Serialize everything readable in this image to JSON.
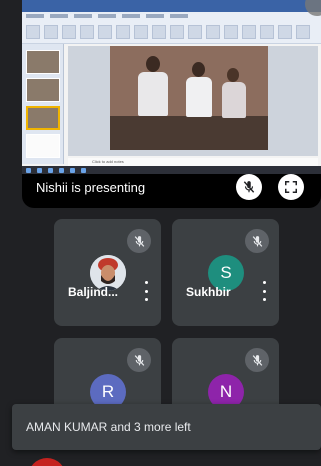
{
  "presentation": {
    "presenter_label": "Nishii is presenting",
    "slide_note": "Click to add notes"
  },
  "participants": [
    {
      "name": "Baljind...",
      "avatar_letter": "",
      "avatar_color": "#3c4043"
    },
    {
      "name": "Sukhbir",
      "avatar_letter": "S",
      "avatar_color": "#1e8e7e"
    },
    {
      "name": "",
      "avatar_letter": "R",
      "avatar_color": "#5c6bc0"
    },
    {
      "name": "",
      "avatar_letter": "N",
      "avatar_color": "#8e24aa"
    }
  ],
  "toast": {
    "message": "AMAN KUMAR and 3 more left"
  },
  "colors": {
    "background": "#202124",
    "tile": "#3c4043",
    "end_call": "#c5221f"
  },
  "icons": {
    "presenter_mute": "mic-off-icon",
    "fullscreen": "fullscreen-icon",
    "tile_mute": "mic-off-icon",
    "more": "more-vert-icon"
  }
}
